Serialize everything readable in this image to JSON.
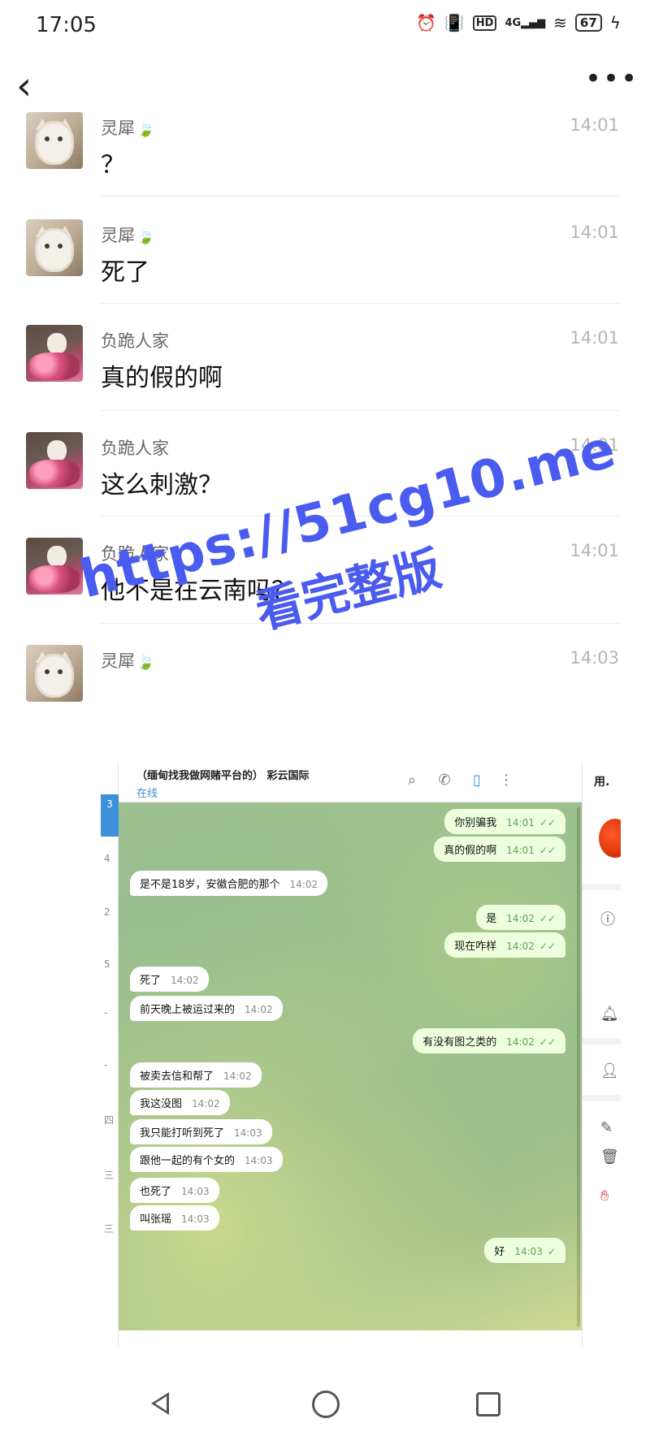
{
  "status_bar": {
    "time": "17:05",
    "network": "4G",
    "hd": "HD",
    "battery": "67",
    "icons": [
      "alarm-icon",
      "vibrate-icon",
      "hd-icon",
      "signal-icon",
      "wifi-icon",
      "battery-icon",
      "charging-icon"
    ]
  },
  "nav": {
    "back_glyph": "‹",
    "more_glyph": "•••"
  },
  "comments": [
    {
      "name": "灵犀",
      "leaf": "🍃",
      "time": "14:01",
      "text": "？",
      "avatar": "cat"
    },
    {
      "name": "灵犀",
      "leaf": "🍃",
      "time": "14:01",
      "text": "死了",
      "avatar": "cat"
    },
    {
      "name": "负跪人家",
      "leaf": "",
      "time": "14:01",
      "text": "真的假的啊",
      "avatar": "flower"
    },
    {
      "name": "负跪人家",
      "leaf": "",
      "time": "14:01",
      "text": "这么刺激？",
      "avatar": "flower"
    },
    {
      "name": "负跪人家",
      "leaf": "",
      "time": "14:01",
      "text": "他不是在云南吗？",
      "avatar": "flower"
    },
    {
      "name": "灵犀",
      "leaf": "🍃",
      "time": "14:03",
      "text": "",
      "avatar": "cat"
    }
  ],
  "embedded": {
    "group_name": "（缅甸找我做网赌平台的） 彩云国际",
    "group_status": "在线",
    "right_title": "用.",
    "left_numbers": [
      "3",
      "4",
      "2",
      "5",
      "-",
      "-",
      "四",
      "三",
      "三"
    ],
    "messages": [
      {
        "dir": "out",
        "text": "你别骗我",
        "time": "14:01",
        "tick": "✓✓"
      },
      {
        "dir": "out",
        "text": "真的假的啊",
        "time": "14:01",
        "tick": "✓✓"
      },
      {
        "dir": "in",
        "text": "是不是18岁，安徽合肥的那个",
        "time": "14:02",
        "tick": ""
      },
      {
        "dir": "out",
        "text": "是",
        "time": "14:02",
        "tick": "✓✓"
      },
      {
        "dir": "out",
        "text": "现在咋样",
        "time": "14:02",
        "tick": "✓✓"
      },
      {
        "dir": "in",
        "text": "死了",
        "time": "14:02",
        "tick": ""
      },
      {
        "dir": "in",
        "text": "前天晚上被运过来的",
        "time": "14:02",
        "tick": ""
      },
      {
        "dir": "out",
        "text": "有没有图之类的",
        "time": "14:02",
        "tick": "✓✓"
      },
      {
        "dir": "in",
        "text": "被卖去信和帮了",
        "time": "14:02",
        "tick": ""
      },
      {
        "dir": "in",
        "text": "我这没图",
        "time": "14:02",
        "tick": ""
      },
      {
        "dir": "in",
        "text": "我只能打听到死了",
        "time": "14:03",
        "tick": ""
      },
      {
        "dir": "in",
        "text": "跟他一起的有个女的",
        "time": "14:03",
        "tick": ""
      },
      {
        "dir": "in",
        "text": "也死了",
        "time": "14:03",
        "tick": ""
      },
      {
        "dir": "in",
        "text": "叫张瑶",
        "time": "14:03",
        "tick": ""
      },
      {
        "dir": "out",
        "text": "好",
        "time": "14:03",
        "tick": "✓"
      }
    ]
  },
  "watermark": {
    "line1": "https://51cg10.me",
    "line2": "看完整版"
  },
  "colors": {
    "watermark": "#4a5bf0",
    "time_gray": "#b5b5b5",
    "name_gray": "#666666"
  }
}
